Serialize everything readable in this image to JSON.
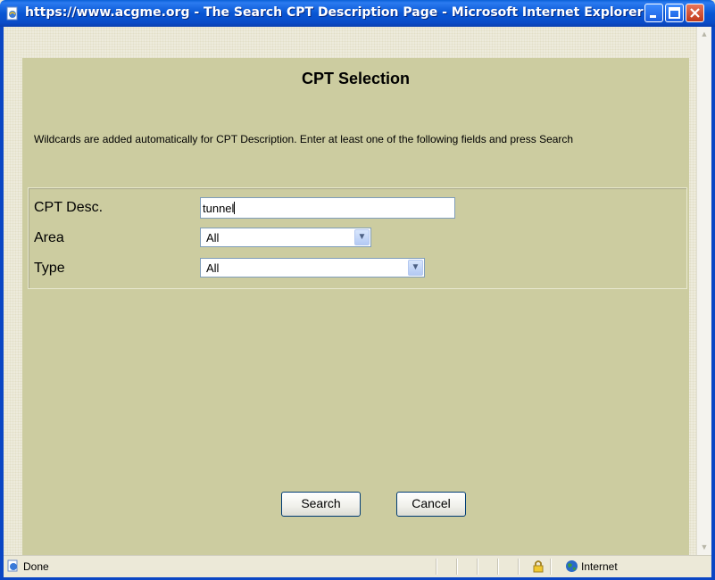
{
  "window": {
    "title": "https://www.acgme.org - The Search CPT Description Page - Microsoft Internet Explorer",
    "icons": [
      "ie-page-icon",
      "minimize-icon",
      "maximize-icon",
      "close-icon"
    ]
  },
  "form": {
    "heading": "CPT Selection",
    "instructions": "Wildcards are added automatically for CPT Description. Enter at least one of the following fields and press Search",
    "fields": {
      "cpt_desc": {
        "label": "CPT Desc.",
        "value": "tunnel"
      },
      "area": {
        "label": "Area",
        "selected": "All"
      },
      "type": {
        "label": "Type",
        "selected": "All"
      }
    },
    "buttons": {
      "search": "Search",
      "cancel": "Cancel"
    }
  },
  "statusbar": {
    "status": "Done",
    "zone": "Internet",
    "icons": [
      "ie-done-icon",
      "lock-icon",
      "globe-icon"
    ]
  },
  "colors": {
    "titlebar": "#0A5FD8",
    "panel": "#CCCCA0",
    "client": "#EDEBDC"
  }
}
